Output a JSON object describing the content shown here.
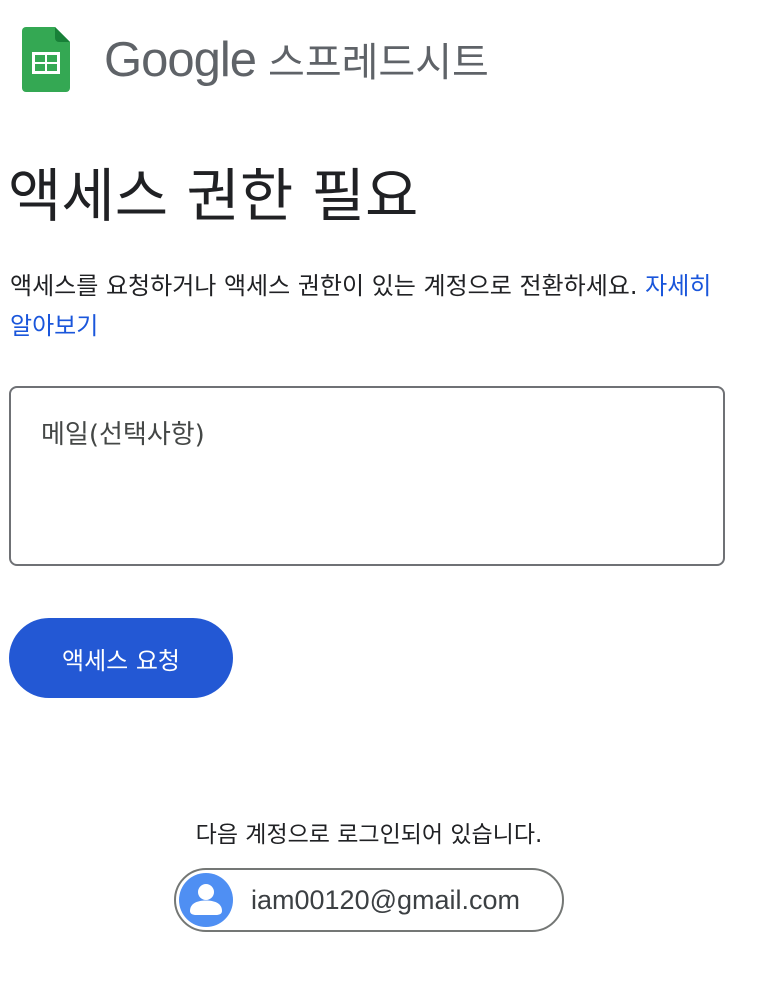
{
  "header": {
    "brand_google": "Google",
    "brand_product": "스프레드시트",
    "logo_icon": "google-sheets-icon",
    "logo_color": "#34a853"
  },
  "main": {
    "title": "액세스 권한 필요",
    "description": "액세스를 요청하거나 액세스 권한이 있는 계정으로 전환하세요.",
    "learn_more": "자세히 알아보기",
    "email_placeholder": "메일(선택사항)",
    "email_value": "",
    "request_button": "액세스 요청"
  },
  "account": {
    "signed_in_label": "다음 계정으로 로그인되어 있습니다.",
    "email": "iam00120@gmail.com",
    "avatar_icon": "person-icon",
    "avatar_color": "#4f8ff3"
  },
  "colors": {
    "accent": "#2358d4",
    "link": "#1a56db",
    "text": "#202124",
    "brand_gray": "#5f6368"
  }
}
